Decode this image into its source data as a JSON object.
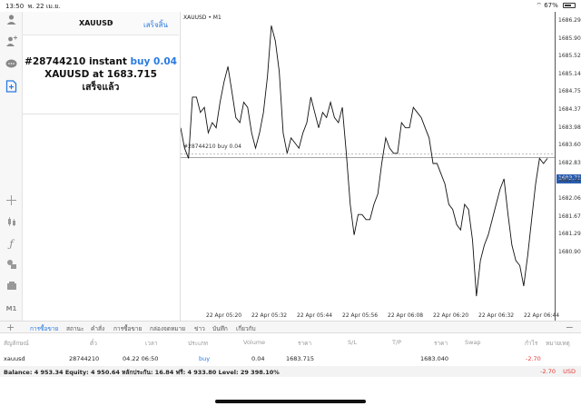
{
  "status_bar": {
    "time": "13:50",
    "date": "พ. 22 เม.ย.",
    "battery": "67%"
  },
  "left_toolbar": {
    "icons": [
      "user-icon",
      "user-add-icon",
      "chat-icon",
      "new-order-icon",
      "crosshair-icon",
      "candles-icon",
      "function-icon",
      "objects-icon",
      "templates-icon",
      "timeframe-icon"
    ],
    "timeframe": "M1"
  },
  "panel": {
    "symbol": "XAUUSD",
    "caret": "▾",
    "done": "เสร็จสิ้น",
    "line1_prefix": "#28744210 instant",
    "line1_action": "buy 0.04",
    "line2": "XAUUSD at 1683.715",
    "line3": "เสร็จแล้ว"
  },
  "chart": {
    "title": "XAUUSD • M1",
    "order_label": "#28744210 buy 0.04",
    "current_price": "1683.715"
  },
  "chart_data": {
    "type": "line",
    "title": "XAUUSD • M1",
    "x_ticks": [
      "22 Apr 05:20",
      "22 Apr 05:32",
      "22 Apr 05:44",
      "22 Apr 05:56",
      "22 Apr 06:08",
      "22 Apr 06:20",
      "22 Apr 06:32",
      "22 Apr 06:44"
    ],
    "y_ticks": [
      "1686.291",
      "1685.906",
      "1685.525",
      "1685.140",
      "1684.755",
      "1684.370",
      "1683.985",
      "1683.600",
      "1683.715",
      "1682.830",
      "1682.445",
      "1682.060",
      "1681.675",
      "1681.290",
      "1680.905"
    ],
    "ylim": [
      1680.7,
      1686.5
    ],
    "order_price": 1683.79,
    "current_price": 1683.715,
    "values": [
      1684.3,
      1683.9,
      1683.7,
      1684.9,
      1684.9,
      1684.6,
      1684.7,
      1684.2,
      1684.4,
      1684.3,
      1684.8,
      1685.2,
      1685.5,
      1685.0,
      1684.5,
      1684.4,
      1684.8,
      1684.7,
      1684.2,
      1683.9,
      1684.2,
      1684.6,
      1685.3,
      1686.3,
      1686.0,
      1685.4,
      1684.2,
      1683.8,
      1684.1,
      1684.0,
      1683.9,
      1684.2,
      1684.4,
      1684.9,
      1684.6,
      1684.3,
      1684.6,
      1684.5,
      1684.8,
      1684.5,
      1684.4,
      1684.7,
      1683.8,
      1682.8,
      1682.2,
      1682.6,
      1682.6,
      1682.5,
      1682.5,
      1682.8,
      1683.0,
      1683.6,
      1684.1,
      1683.9,
      1683.8,
      1683.8,
      1684.4,
      1684.3,
      1684.3,
      1684.7,
      1684.6,
      1684.5,
      1684.3,
      1684.1,
      1683.6,
      1683.6,
      1683.4,
      1683.2,
      1682.8,
      1682.7,
      1682.4,
      1682.3,
      1682.8,
      1682.7,
      1682.1,
      1681.0,
      1681.7,
      1682.0,
      1682.2,
      1682.5,
      1682.8,
      1683.1,
      1683.3,
      1682.6,
      1682.0,
      1681.7,
      1681.6,
      1681.2,
      1681.8,
      1682.5,
      1683.2,
      1683.7,
      1683.6,
      1683.7
    ]
  },
  "bottom_tabs": [
    "การซื้อขาย",
    "สถานะ",
    "คำสั่ง",
    "การซื้อขาย",
    "กล่องจดหมาย",
    "ข่าว",
    "บันทึก",
    "เกี่ยวกับ"
  ],
  "table": {
    "headers": [
      "สัญลักษณ์",
      "ตั๋ว",
      "เวลา",
      "ประเภท",
      "Volume",
      "ราคา",
      "S/L",
      "T/P",
      "ราคา",
      "Swap",
      "กำไร",
      "หมายเหตุ"
    ],
    "row": {
      "symbol": "xauusd",
      "ticket": "28744210",
      "time": "04.22 06:50",
      "type": "buy",
      "volume": "0.04",
      "price_open": "1683.715",
      "price_current": "1683.040",
      "profit": "-2.70"
    }
  },
  "balance": {
    "text": "Balance: 4 953.34 Equity: 4 950.64 หลักประกัน: 16.84 ฟรี: 4 933.80 Level: 29 398.10%",
    "profit": "-2.70",
    "currency": "USD"
  },
  "colors": {
    "accent": "#2a7ae2",
    "loss": "#e53935",
    "price_tag": "#2a5db0"
  }
}
